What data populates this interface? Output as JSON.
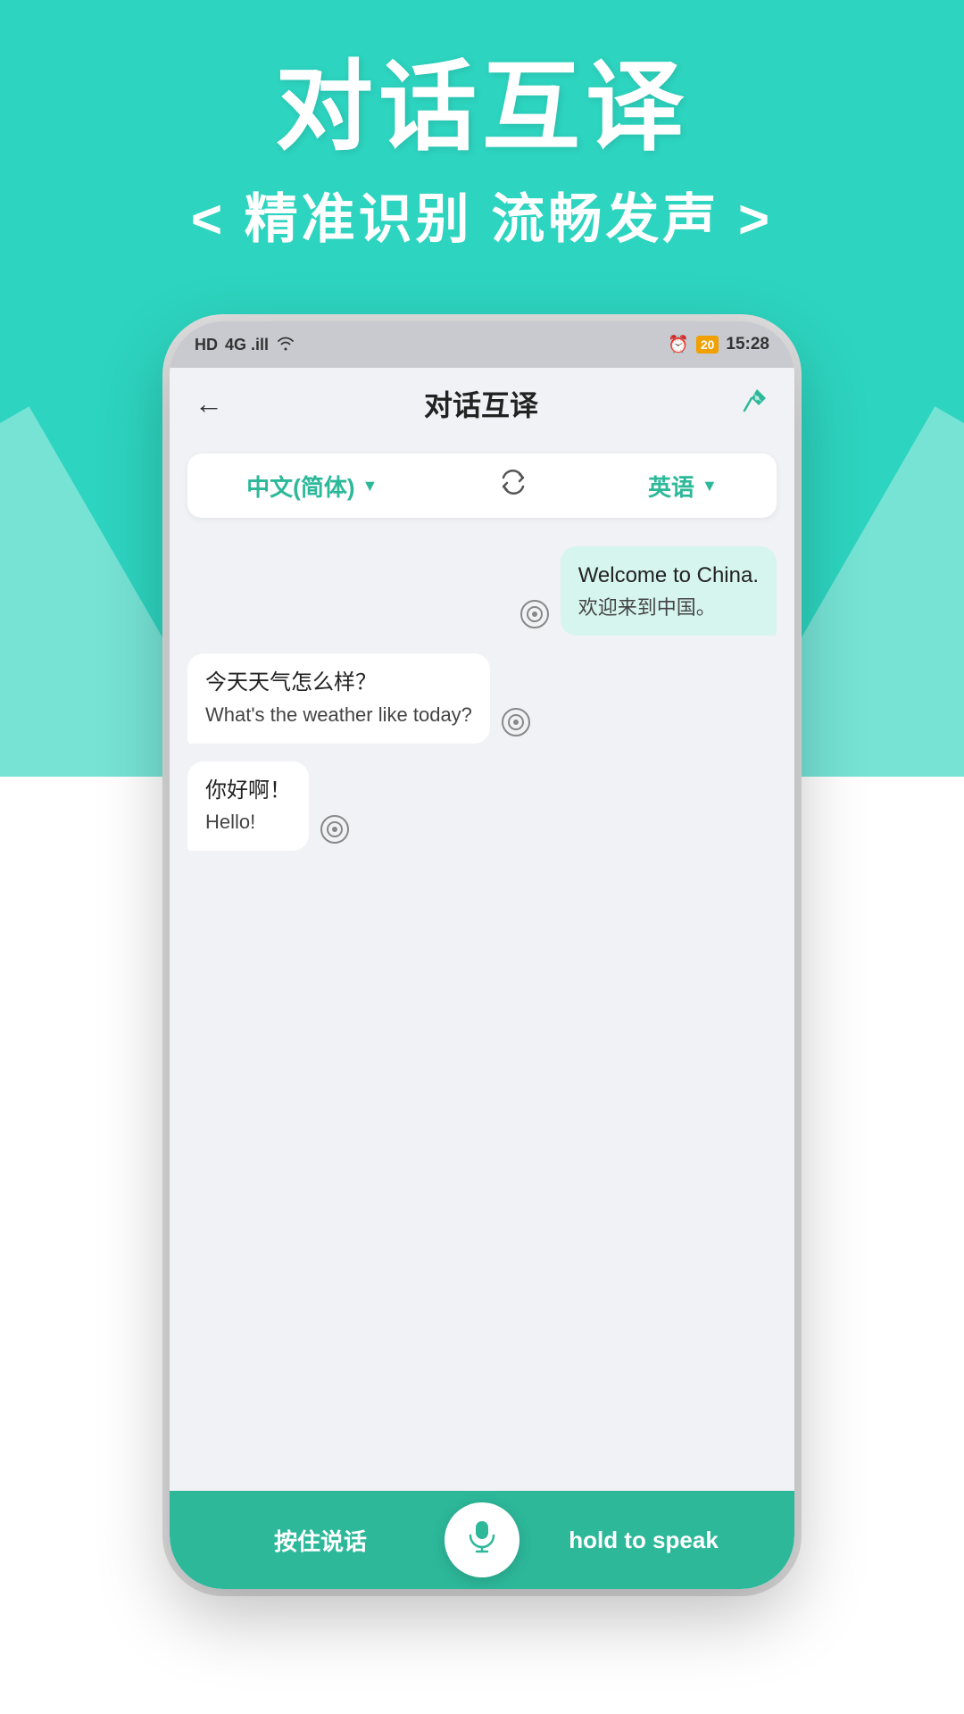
{
  "background": {
    "teal_color": "#2DD4BF",
    "white_color": "#ffffff"
  },
  "header": {
    "main_title": "对话互译",
    "sub_title": "< 精准识别  流畅发声 >"
  },
  "status_bar": {
    "left_items": "HD  46  ▾  📶  WiFi",
    "time": "15:28",
    "battery": "20",
    "alarm_icon": "⏰"
  },
  "app_header": {
    "back_label": "←",
    "title": "对话互译",
    "pin_icon": "📌"
  },
  "lang_selector": {
    "source_lang": "中文(简体)",
    "target_lang": "英语",
    "source_arrow": "▼",
    "target_arrow": "▼",
    "swap_icon": "🔄"
  },
  "chat": {
    "messages": [
      {
        "side": "right",
        "text_main": "Welcome to China.",
        "text_sub": "欢迎来到中国。",
        "speak_icon": "⊙"
      },
      {
        "side": "left",
        "text_main": "今天天气怎么样？",
        "text_sub": "What's the weather like today?",
        "speak_icon": "⊙"
      },
      {
        "side": "left",
        "text_main": "你好啊！",
        "text_sub": "Hello!",
        "speak_icon": "⊙"
      }
    ]
  },
  "bottom_bar": {
    "left_button": "按住说话",
    "right_button": "hold to speak",
    "mic_label": "mic"
  }
}
